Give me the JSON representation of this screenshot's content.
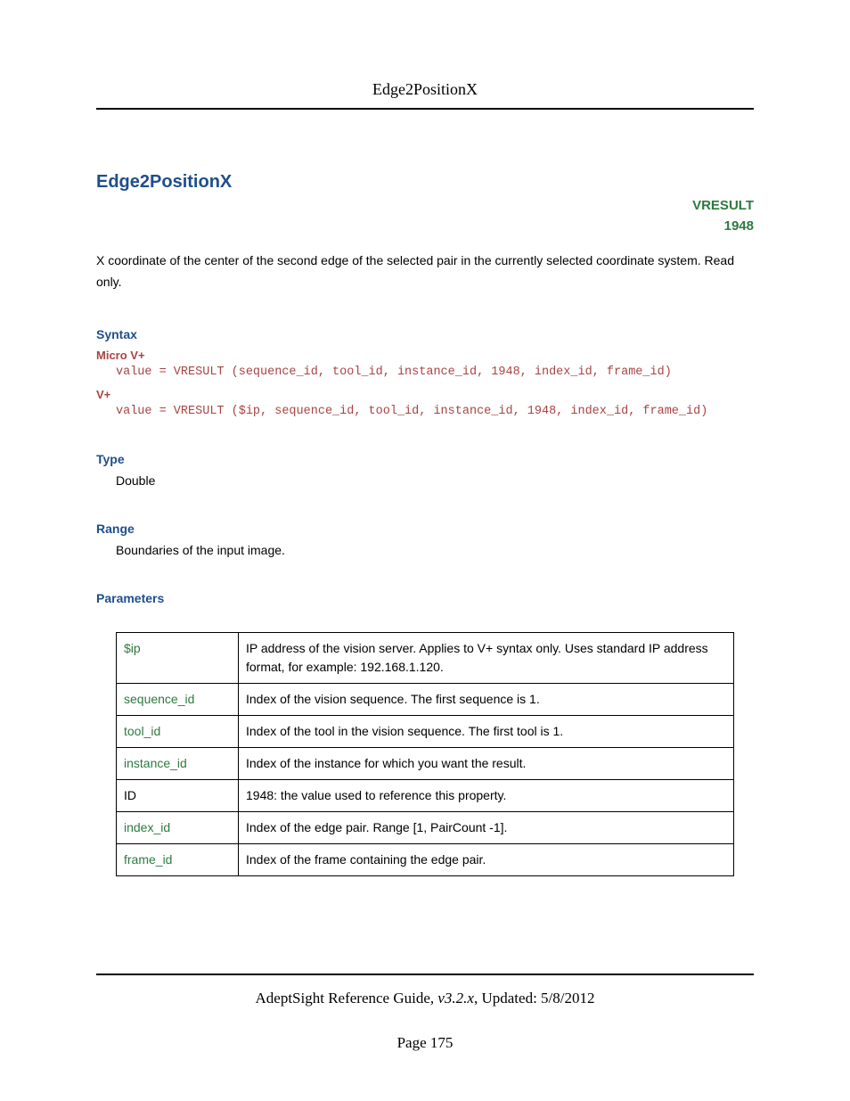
{
  "header": {
    "running_title": "Edge2PositionX"
  },
  "main": {
    "title": "Edge2PositionX",
    "tag_line1": "VRESULT",
    "tag_line2": "1948",
    "description": "X coordinate of the center of the second edge of the selected pair in the currently selected coordinate system. Read only.",
    "syntax": {
      "heading": "Syntax",
      "micro_label": "Micro V+",
      "micro_code": "value = VRESULT (sequence_id, tool_id, instance_id, 1948, index_id, frame_id)",
      "vplus_label": "V+",
      "vplus_code": "value = VRESULT ($ip, sequence_id, tool_id, instance_id, 1948, index_id, frame_id)"
    },
    "type": {
      "heading": "Type",
      "value": "Double"
    },
    "range": {
      "heading": "Range",
      "value": "Boundaries of the input image."
    },
    "parameters": {
      "heading": "Parameters",
      "rows": [
        {
          "name": "$ip",
          "desc": "IP address of the vision server. Applies to V+ syntax only. Uses standard IP address format, for example: 192.168.1.120."
        },
        {
          "name": "sequence_id",
          "desc": "Index of the vision sequence. The first sequence is 1."
        },
        {
          "name": "tool_id",
          "desc": "Index of the tool in the vision sequence. The first tool is 1."
        },
        {
          "name": "instance_id",
          "desc": "Index of the instance for which you want the result."
        },
        {
          "name": "ID",
          "desc": "1948: the value used to reference this property."
        },
        {
          "name": "index_id",
          "desc": "Index of the edge pair. Range [1, PairCount -1]."
        },
        {
          "name": "frame_id",
          "desc": "Index of the frame containing the edge pair."
        }
      ]
    }
  },
  "footer": {
    "doc_title": "AdeptSight Reference Guide",
    "version": ", v3.2.x",
    "updated": ", Updated: 5/8/2012",
    "page_label": "Page 175"
  }
}
